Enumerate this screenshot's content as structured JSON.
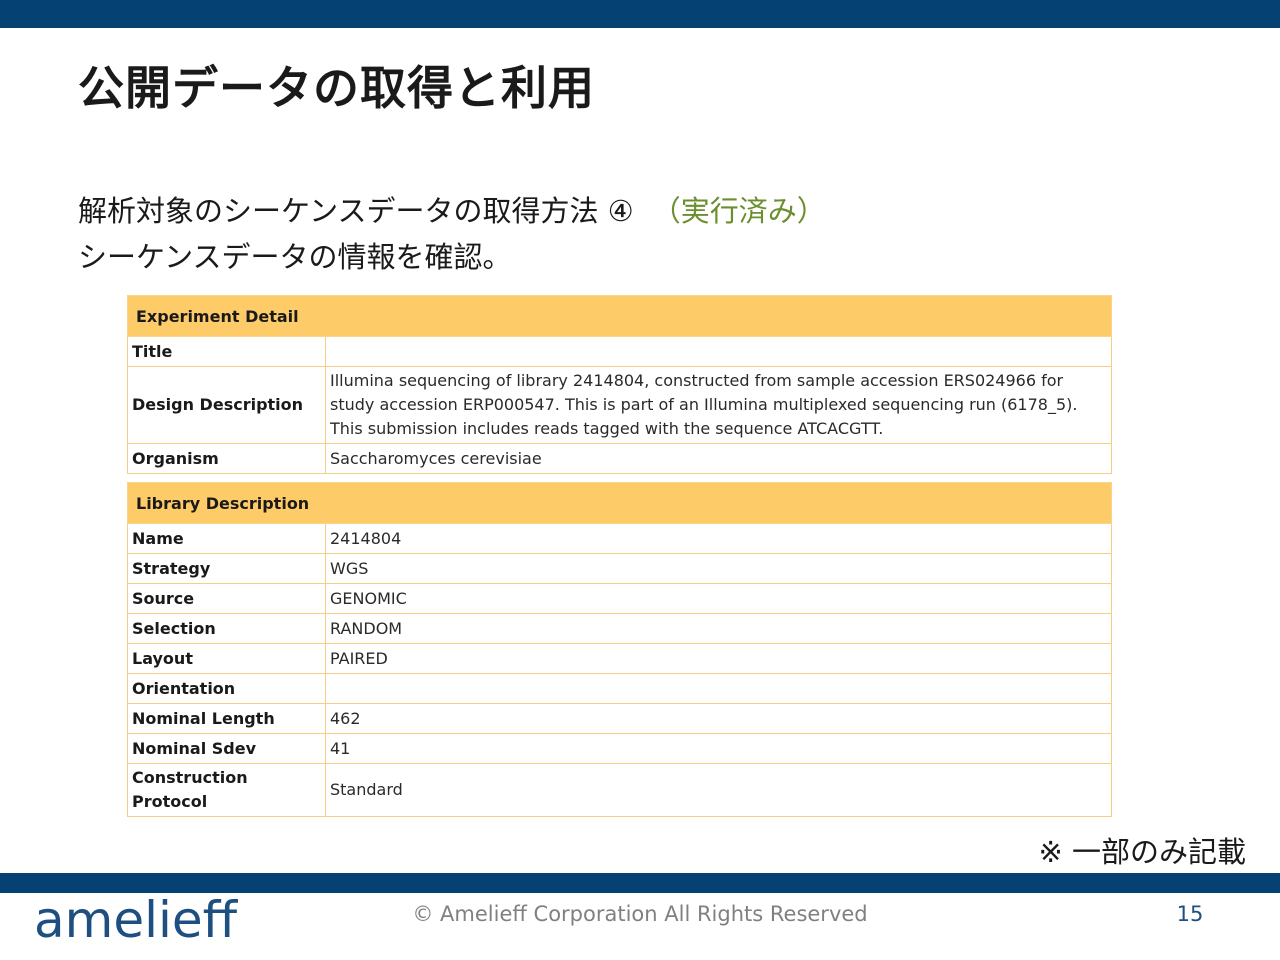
{
  "slide": {
    "title": "公開データの取得と利用",
    "subtitle_line1": "解析対象のシーケンスデータの取得方法 ④",
    "subtitle_status": "（実行済み）",
    "subtitle_line2": "シーケンスデータの情報を確認。",
    "note": "※ 一部のみ記載"
  },
  "experiment": {
    "header": "Experiment Detail",
    "rows": [
      {
        "key": "Title",
        "value": ""
      },
      {
        "key": "Design Description",
        "value": "Illumina sequencing of library 2414804, constructed from sample accession ERS024966 for study accession ERP000547. This is part of an Illumina multiplexed sequencing run (6178_5). This submission includes reads tagged with the sequence ATCACGTT."
      },
      {
        "key": "Organism",
        "value": "Saccharomyces cerevisiae"
      }
    ]
  },
  "library": {
    "header": "Library Description",
    "rows": [
      {
        "key": "Name",
        "value": "2414804"
      },
      {
        "key": "Strategy",
        "value": "WGS"
      },
      {
        "key": "Source",
        "value": "GENOMIC"
      },
      {
        "key": "Selection",
        "value": "RANDOM"
      },
      {
        "key": "Layout",
        "value": "PAIRED"
      },
      {
        "key": "Orientation",
        "value": ""
      },
      {
        "key": "Nominal Length",
        "value": "462"
      },
      {
        "key": "Nominal Sdev",
        "value": "41"
      },
      {
        "key": "Construction Protocol",
        "value": "Standard"
      }
    ]
  },
  "footer": {
    "logo": "amelieff",
    "copyright": "© Amelieff Corporation All Rights Reserved",
    "page_number": "15"
  },
  "colors": {
    "brand_bar": "#054273",
    "table_header": "#fdcb68",
    "table_border": "#f5cf86",
    "status_green": "#6b8f2e"
  }
}
